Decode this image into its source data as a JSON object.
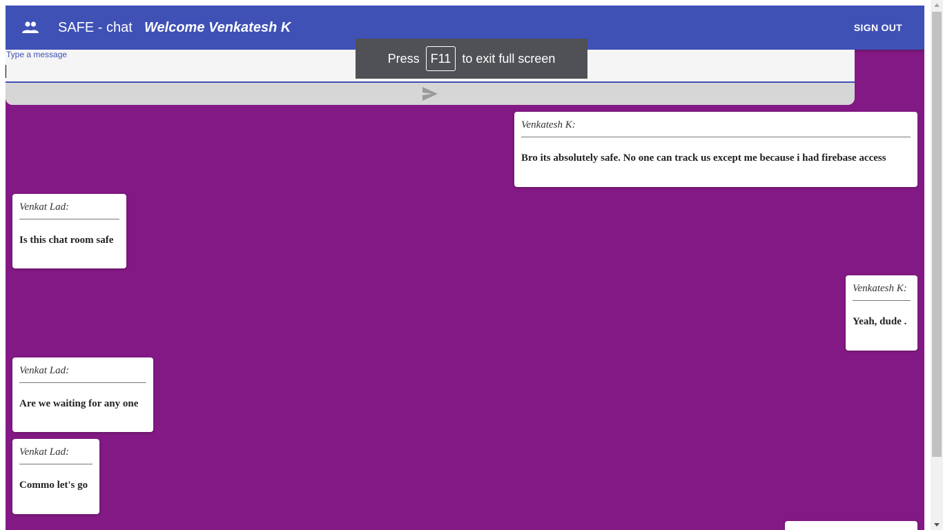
{
  "appbar": {
    "icon": "people-icon",
    "title": "SAFE - chat",
    "welcome": "Welcome Venkatesh K",
    "signout_label": "SIGN OUT"
  },
  "composer": {
    "placeholder": "Type a message",
    "send_icon": "send-icon"
  },
  "fullscreen_toast": {
    "before": "Press",
    "key": "F11",
    "after": "to exit full screen"
  },
  "messages": [
    {
      "author": "Venkatesh K:",
      "text": "Bro its absolutely safe. No one can track us except me because i had firebase access",
      "side": "right"
    },
    {
      "author": "Venkat Lad:",
      "text": "Is this chat room safe",
      "side": "left"
    },
    {
      "author": "Venkatesh K:",
      "text": "Yeah, dude .",
      "side": "right"
    },
    {
      "author": "Venkat Lad:",
      "text": "Are we waiting for any one",
      "side": "left"
    },
    {
      "author": "Venkat Lad:",
      "text": "Commo let's go",
      "side": "left"
    }
  ],
  "colors": {
    "appbar": "#3f51b5",
    "background": "#831984",
    "message_bg": "#ffffff"
  }
}
